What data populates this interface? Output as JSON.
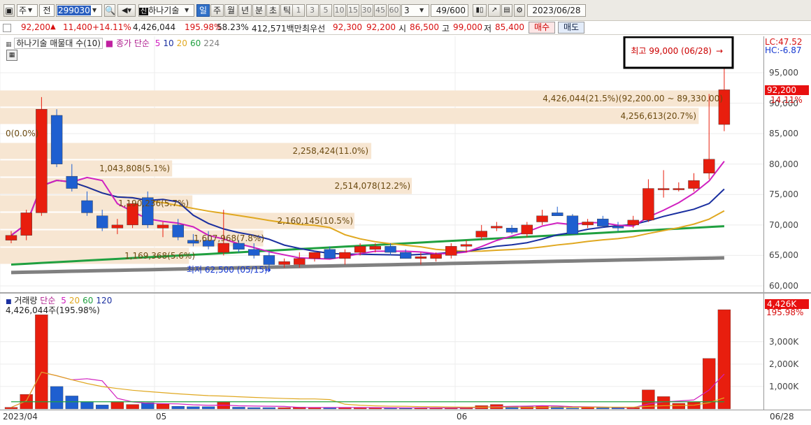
{
  "toolbar": {
    "market_label": "주",
    "view_label": "전",
    "stock_code": "299030",
    "stock_name": "하나기술",
    "period_tabs": [
      "일",
      "주",
      "월",
      "년",
      "분",
      "초",
      "틱"
    ],
    "active_period": "일",
    "interval_buttons": [
      "1",
      "3",
      "5",
      "10",
      "15",
      "30",
      "45",
      "60"
    ],
    "interval_value": "3",
    "count_current": "49",
    "count_max": "/600",
    "date": "2023/06/28"
  },
  "price_bar": {
    "price": "92,200",
    "change": "11,400",
    "change_pct": "+14.11%",
    "volume": "4,426,044",
    "vol_ratio": "195.98%",
    "rate": "58.23%",
    "amount": "412,571백만",
    "ask_label": "최우선",
    "ask": "92,300",
    "bid": "92,200",
    "open_label": "시",
    "open": "86,500",
    "high_label": "고",
    "high": "99,000",
    "low_label": "저",
    "low": "85,400",
    "buy_button": "매수",
    "sell_button": "매도"
  },
  "price_panel": {
    "title": "하나기술 매물대 수(10)",
    "ma_prefix": "종가 단순",
    "ma_periods": [
      "5",
      "10",
      "20",
      "60",
      "224"
    ],
    "ma_colors": [
      "#d020c0",
      "#1a2fa0",
      "#e0a820",
      "#20a040",
      "#808080"
    ],
    "high_note": "최고 99,000 (06/28)",
    "low_note": "최저 62,500 (05/15)",
    "volume_profile": [
      {
        "label": "4,426,044(21.5%)(92,200.00 ~ 89,330.00)",
        "pct": 21.5,
        "lo": 89330,
        "hi": 92200
      },
      {
        "label": "4,256,613(20.7%)",
        "pct": 20.7,
        "lo": 86460,
        "hi": 89330
      },
      {
        "label": "0(0.0%)",
        "pct": 0.0,
        "lo": 83590,
        "hi": 86460
      },
      {
        "label": "2,258,424(11.0%)",
        "pct": 11.0,
        "lo": 80720,
        "hi": 83590
      },
      {
        "label": "1,043,808(5.1%)",
        "pct": 5.1,
        "lo": 77850,
        "hi": 80720
      },
      {
        "label": "2,514,078(12.2%)",
        "pct": 12.2,
        "lo": 74980,
        "hi": 77850
      },
      {
        "label": "1,190,236(5.7%)",
        "pct": 5.7,
        "lo": 72110,
        "hi": 74980
      },
      {
        "label": "2,160,145(10.5%)",
        "pct": 10.5,
        "lo": 69240,
        "hi": 72110
      },
      {
        "label": "1,607,968(7.8%)",
        "pct": 7.8,
        "lo": 66370,
        "hi": 69240
      },
      {
        "label": "1,169,368(5.6%)",
        "pct": 5.6,
        "lo": 63500,
        "hi": 66370
      }
    ]
  },
  "price_axis": {
    "lc": "LC:47.52",
    "hc": "HC:-6.87",
    "ticks": [
      "95,000",
      "90,000",
      "85,000",
      "80,000",
      "75,000",
      "70,000",
      "65,000",
      "60,000"
    ],
    "current_price": "92,200",
    "current_pct": "14.11%"
  },
  "volume_panel": {
    "title": "거래량",
    "ma_prefix": "단순",
    "ma_periods": [
      "5",
      "20",
      "60",
      "120"
    ],
    "ma_colors": [
      "#d020c0",
      "#e0a820",
      "#20a040",
      "#1a2fa0"
    ],
    "current_label": "4,426,044주(195.98%)"
  },
  "volume_axis": {
    "ticks": [
      "3,000K",
      "2,000K",
      "1,000K"
    ],
    "current": "4,426K",
    "current_pct": "195.98%"
  },
  "date_axis": {
    "labels": [
      "2023/04",
      "05",
      "06",
      "06/28"
    ]
  },
  "chart_data": {
    "type": "candlestick",
    "x_unit": "trading day index (2023/04/27 – 2023/06/28)",
    "ylim": [
      59500,
      101000
    ],
    "candles": [
      {
        "o": 67500,
        "h": 69000,
        "l": 67000,
        "c": 68300
      },
      {
        "o": 68300,
        "h": 72500,
        "l": 67500,
        "c": 72000
      },
      {
        "o": 72000,
        "h": 91000,
        "l": 71500,
        "c": 89000
      },
      {
        "o": 88000,
        "h": 89000,
        "l": 79500,
        "c": 80000
      },
      {
        "o": 78000,
        "h": 80000,
        "l": 75500,
        "c": 76000
      },
      {
        "o": 74000,
        "h": 75500,
        "l": 71500,
        "c": 72000
      },
      {
        "o": 71500,
        "h": 72500,
        "l": 69000,
        "c": 69500
      },
      {
        "o": 69500,
        "h": 71000,
        "l": 68500,
        "c": 70000
      },
      {
        "o": 70000,
        "h": 74000,
        "l": 69500,
        "c": 73500
      },
      {
        "o": 74500,
        "h": 75500,
        "l": 69500,
        "c": 70000
      },
      {
        "o": 69500,
        "h": 70500,
        "l": 68000,
        "c": 70000
      },
      {
        "o": 70000,
        "h": 71000,
        "l": 67500,
        "c": 68000
      },
      {
        "o": 67500,
        "h": 68500,
        "l": 66500,
        "c": 67000
      },
      {
        "o": 67500,
        "h": 69000,
        "l": 66000,
        "c": 66500
      },
      {
        "o": 65500,
        "h": 72500,
        "l": 65000,
        "c": 67000
      },
      {
        "o": 67000,
        "h": 67500,
        "l": 65500,
        "c": 66000
      },
      {
        "o": 66000,
        "h": 67000,
        "l": 64500,
        "c": 65000
      },
      {
        "o": 65000,
        "h": 65500,
        "l": 62500,
        "c": 63500
      },
      {
        "o": 63500,
        "h": 64500,
        "l": 63000,
        "c": 64000
      },
      {
        "o": 63500,
        "h": 65500,
        "l": 63000,
        "c": 64500
      },
      {
        "o": 64500,
        "h": 65500,
        "l": 64000,
        "c": 65500
      },
      {
        "o": 66000,
        "h": 66500,
        "l": 64500,
        "c": 64500
      },
      {
        "o": 64500,
        "h": 66000,
        "l": 63500,
        "c": 65500
      },
      {
        "o": 65500,
        "h": 67000,
        "l": 65000,
        "c": 66500
      },
      {
        "o": 66000,
        "h": 67000,
        "l": 65500,
        "c": 66500
      },
      {
        "o": 66500,
        "h": 67000,
        "l": 65000,
        "c": 65500
      },
      {
        "o": 65500,
        "h": 66000,
        "l": 64500,
        "c": 64500
      },
      {
        "o": 64500,
        "h": 65500,
        "l": 63500,
        "c": 64800
      },
      {
        "o": 64500,
        "h": 65500,
        "l": 64000,
        "c": 65200
      },
      {
        "o": 65000,
        "h": 67000,
        "l": 64500,
        "c": 66500
      },
      {
        "o": 66500,
        "h": 67500,
        "l": 65500,
        "c": 66800
      },
      {
        "o": 68000,
        "h": 70000,
        "l": 67500,
        "c": 69000
      },
      {
        "o": 69500,
        "h": 70500,
        "l": 69000,
        "c": 69800
      },
      {
        "o": 69500,
        "h": 70000,
        "l": 68500,
        "c": 68800
      },
      {
        "o": 68500,
        "h": 70500,
        "l": 68000,
        "c": 70000
      },
      {
        "o": 70500,
        "h": 72500,
        "l": 70000,
        "c": 71500
      },
      {
        "o": 72000,
        "h": 73000,
        "l": 71500,
        "c": 71500
      },
      {
        "o": 71500,
        "h": 71800,
        "l": 68500,
        "c": 68500
      },
      {
        "o": 70000,
        "h": 71000,
        "l": 69500,
        "c": 70500
      },
      {
        "o": 71000,
        "h": 71500,
        "l": 69500,
        "c": 69800
      },
      {
        "o": 69800,
        "h": 70500,
        "l": 69000,
        "c": 69500
      },
      {
        "o": 70000,
        "h": 71500,
        "l": 69500,
        "c": 70800
      },
      {
        "o": 70800,
        "h": 77500,
        "l": 70500,
        "c": 76000
      },
      {
        "o": 76000,
        "h": 79000,
        "l": 74500,
        "c": 76000
      },
      {
        "o": 76000,
        "h": 77000,
        "l": 75500,
        "c": 76000
      },
      {
        "o": 76000,
        "h": 78500,
        "l": 75500,
        "c": 77300
      },
      {
        "o": 78500,
        "h": 91500,
        "l": 77500,
        "c": 80800
      },
      {
        "o": 86500,
        "h": 99000,
        "l": 85400,
        "c": 92200
      }
    ],
    "volume_k": [
      70,
      650,
      4200,
      1000,
      580,
      300,
      180,
      300,
      200,
      280,
      220,
      120,
      100,
      100,
      300,
      80,
      60,
      60,
      60,
      80,
      60,
      60,
      60,
      60,
      50,
      40,
      30,
      60,
      50,
      50,
      60,
      150,
      200,
      120,
      100,
      150,
      100,
      40,
      80,
      50,
      60,
      60,
      850,
      550,
      250,
      300,
      2250,
      4426
    ]
  }
}
